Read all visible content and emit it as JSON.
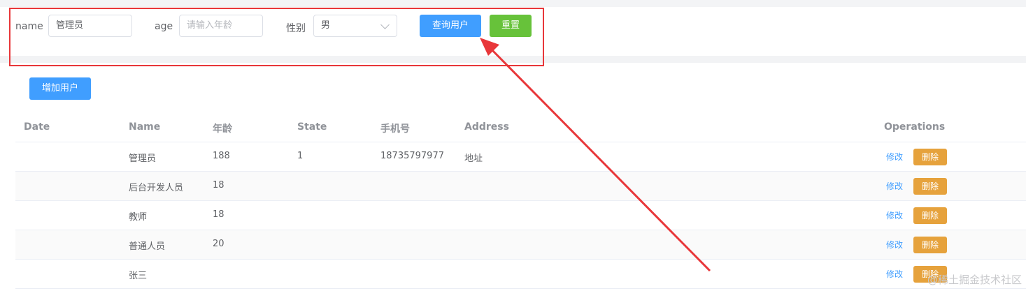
{
  "search": {
    "name_label": "name",
    "name_value": "管理员",
    "age_label": "age",
    "age_placeholder": "请输入年龄",
    "gender_label": "性别",
    "gender_value": "男",
    "query_button": "查询用户",
    "reset_button": "重置"
  },
  "toolbar": {
    "add_button": "增加用户"
  },
  "table": {
    "headers": {
      "date": "Date",
      "name": "Name",
      "age": "年龄",
      "state": "State",
      "phone": "手机号",
      "address": "Address",
      "operations": "Operations"
    },
    "rows": [
      {
        "date": "",
        "name": "管理员",
        "age": "188",
        "state": "1",
        "phone": "18735797977",
        "address": "地址"
      },
      {
        "date": "",
        "name": "后台开发人员",
        "age": "18",
        "state": "",
        "phone": "",
        "address": ""
      },
      {
        "date": "",
        "name": "教师",
        "age": "18",
        "state": "",
        "phone": "",
        "address": ""
      },
      {
        "date": "",
        "name": "普通人员",
        "age": "20",
        "state": "",
        "phone": "",
        "address": ""
      },
      {
        "date": "",
        "name": "张三",
        "age": "",
        "state": "",
        "phone": "",
        "address": ""
      }
    ],
    "edit_label": "修改",
    "delete_label": "删除"
  },
  "watermark": "@稀土掘金技术社区",
  "colors": {
    "primary": "#409eff",
    "success": "#67c23a",
    "warning": "#e6a23c",
    "annotation": "#e8373a"
  }
}
